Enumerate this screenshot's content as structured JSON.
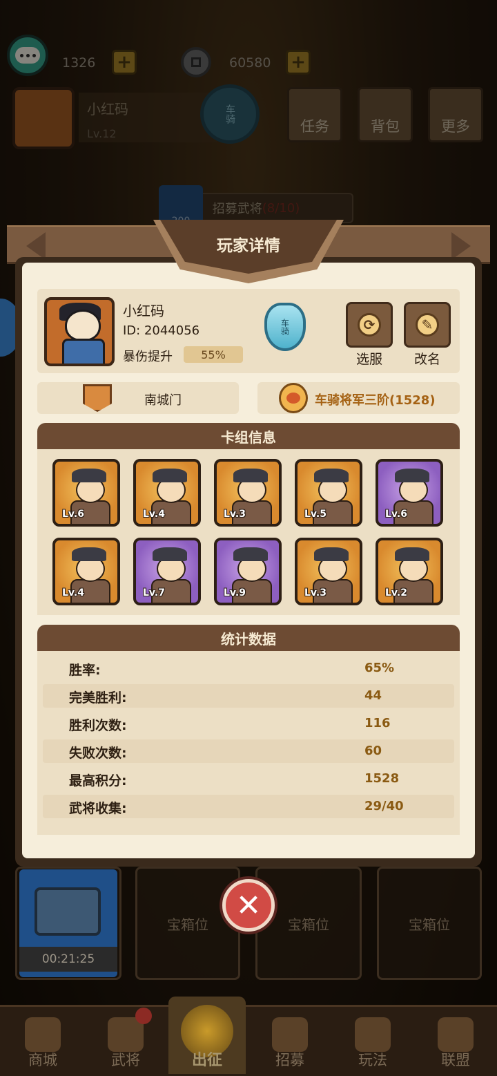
{
  "topbar": {
    "gems": "1326",
    "coins": "60580",
    "player_name": "小红码",
    "player_level": "Lv.12",
    "rank_glyph": "车骑",
    "menu": [
      {
        "label": "任务"
      },
      {
        "label": "背包"
      },
      {
        "label": "更多"
      }
    ],
    "recruit_cost": "200",
    "recruit_label": "招募武将",
    "recruit_count": "(8/10)"
  },
  "modal": {
    "title": "玩家详情",
    "player": {
      "name": "小红码",
      "id": "ID: 2044056",
      "crit_label": "暴伤提升",
      "crit_value": "55%",
      "rank_glyph": "车骑"
    },
    "actions": {
      "select_server": "选服",
      "rename": "改名"
    },
    "gate": "南城门",
    "rank_title": "车骑将军三阶(1528)",
    "deck": {
      "title": "卡组信息",
      "cards": [
        {
          "level": "Lv.6",
          "rarity": "orange"
        },
        {
          "level": "Lv.4",
          "rarity": "orange"
        },
        {
          "level": "Lv.3",
          "rarity": "orange"
        },
        {
          "level": "Lv.5",
          "rarity": "orange"
        },
        {
          "level": "Lv.6",
          "rarity": "purple"
        },
        {
          "level": "Lv.4",
          "rarity": "orange"
        },
        {
          "level": "Lv.7",
          "rarity": "purple"
        },
        {
          "level": "Lv.9",
          "rarity": "purple"
        },
        {
          "level": "Lv.3",
          "rarity": "orange"
        },
        {
          "level": "Lv.2",
          "rarity": "orange"
        }
      ]
    },
    "stats": {
      "title": "统计数据",
      "rows": [
        {
          "label": "胜率:",
          "value": "65%"
        },
        {
          "label": "完美胜利:",
          "value": "44"
        },
        {
          "label": "胜利次数:",
          "value": "116"
        },
        {
          "label": "失败次数:",
          "value": "60"
        },
        {
          "label": "最高积分:",
          "value": "1528"
        },
        {
          "label": "武将收集:",
          "value": "29/40"
        }
      ]
    }
  },
  "chests": {
    "timer": "00:21:25",
    "slot_label": "宝箱位"
  },
  "nav": [
    {
      "label": "商城"
    },
    {
      "label": "武将"
    },
    {
      "label": "出征"
    },
    {
      "label": "招募"
    },
    {
      "label": "玩法"
    },
    {
      "label": "联盟"
    }
  ]
}
